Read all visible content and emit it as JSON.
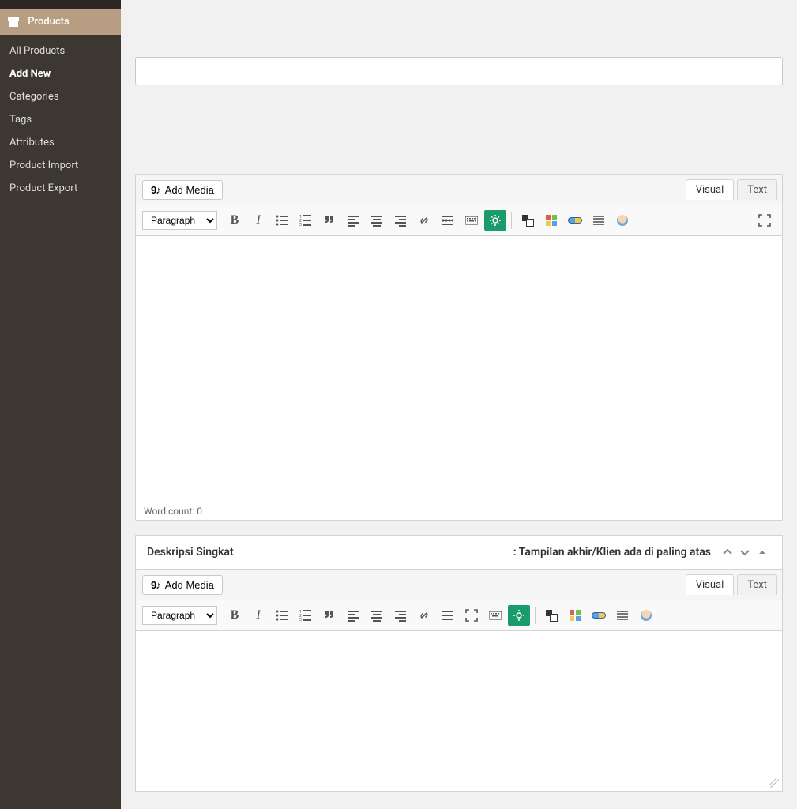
{
  "sidebar": {
    "header": "Products",
    "items": [
      {
        "label": "All Products",
        "active": false
      },
      {
        "label": "Add New",
        "active": true
      },
      {
        "label": "Categories",
        "active": false
      },
      {
        "label": "Tags",
        "active": false
      },
      {
        "label": "Attributes",
        "active": false
      },
      {
        "label": "Product Import",
        "active": false
      },
      {
        "label": "Product Export",
        "active": false
      }
    ]
  },
  "title_field": {
    "value": "",
    "placeholder": ""
  },
  "editor1": {
    "add_media_label": "Add Media",
    "tabs": {
      "visual": "Visual",
      "text": "Text",
      "active": "visual"
    },
    "format_select": "Paragraph",
    "status": {
      "label": "Word count:",
      "value": 0
    }
  },
  "panel2": {
    "title": "Deskripsi Singkat",
    "note": ": Tampilan akhir/Klien ada di paling atas",
    "add_media_label": "Add Media",
    "tabs": {
      "visual": "Visual",
      "text": "Text",
      "active": "visual"
    },
    "format_select": "Paragraph"
  }
}
